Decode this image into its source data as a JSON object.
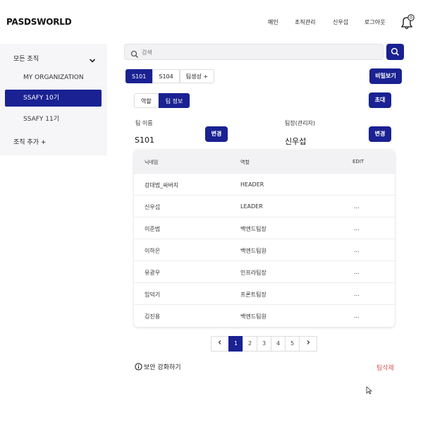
{
  "header": {
    "logo": "PASDSWORLD",
    "nav": [
      "메인",
      "조직관리",
      "신우섭",
      "로그아웃"
    ],
    "notification_count": "0"
  },
  "sidebar": {
    "header_label": "모든 조직",
    "items": [
      {
        "label": "MY ORGANIZATION"
      },
      {
        "label": "SSAFY 10기"
      },
      {
        "label": "SSAFY 11기"
      }
    ],
    "add_label": "조직 추가 +"
  },
  "search": {
    "placeholder": "검색"
  },
  "team_tabs": [
    "S101",
    "S104",
    "팀생성 +"
  ],
  "secret_button": "비밀보기",
  "sub_tabs": [
    "역할",
    "팀 정보"
  ],
  "invite_button": "초대",
  "team_name": {
    "label": "팀 이름",
    "value": "S101",
    "change": "변경"
  },
  "leader": {
    "label": "팀장(관리자)",
    "value": "신우섭",
    "change": "변경"
  },
  "table": {
    "headers": [
      "닉네임",
      "역할",
      "EDIT"
    ],
    "rows": [
      {
        "name": "강대범_싸버지",
        "role": "HEADER",
        "edit": ""
      },
      {
        "name": "신우섭",
        "role": "LEADER",
        "edit": "..."
      },
      {
        "name": "이준범",
        "role": "백엔드팀장",
        "edit": "..."
      },
      {
        "name": "이하은",
        "role": "백엔드팀원",
        "edit": "..."
      },
      {
        "name": "유광우",
        "role": "인프라팀장",
        "edit": "..."
      },
      {
        "name": "임덕기",
        "role": "프론트팀장",
        "edit": "..."
      },
      {
        "name": "김진용",
        "role": "백엔드팀원",
        "edit": "..."
      }
    ]
  },
  "pagination": {
    "pages": [
      "1",
      "2",
      "3",
      "4",
      "5"
    ],
    "current": "1"
  },
  "security_link": "보안 강화하기",
  "delete_team": "팀삭제",
  "colors": {
    "primary": "#1a2192",
    "danger": "#d9534f"
  }
}
